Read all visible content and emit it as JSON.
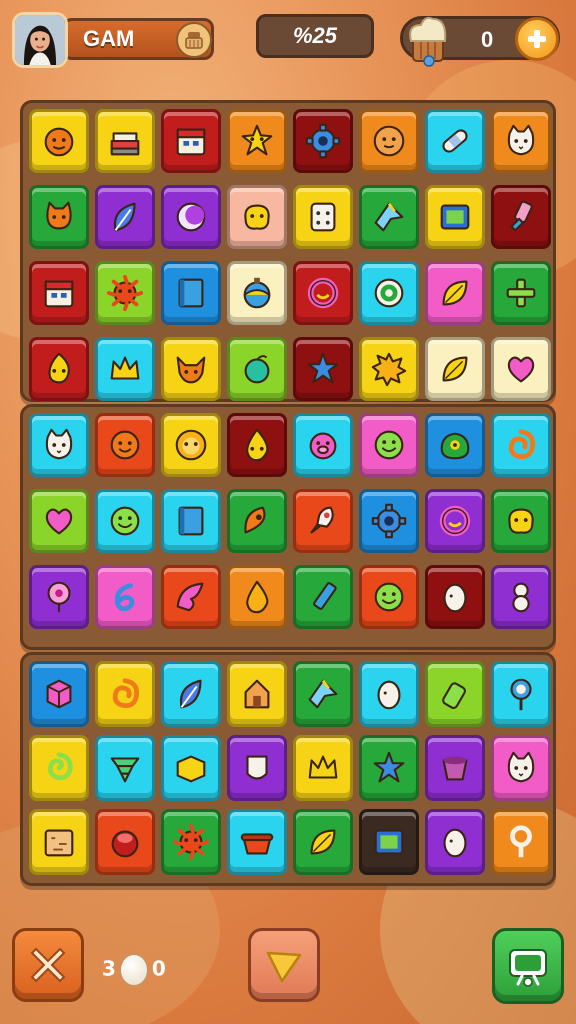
{
  "header": {
    "player_name": "GAM",
    "score": "%25",
    "coins": "0"
  },
  "footer": {
    "counter_left": "3",
    "counter_right": "0"
  },
  "colors": {
    "yellow": "#f7d316",
    "orange": "#f08a1c",
    "red": "#c21d1d",
    "blue": "#1f8fe0",
    "cyan": "#2ad3ee",
    "green": "#27a83a",
    "lime": "#8bd42a",
    "purple": "#8f2ed1",
    "pink": "#f25cc7",
    "cream": "#fbf0c0",
    "redorange": "#e8481a",
    "darkred": "#8e1010",
    "dark": "#3a2a22",
    "peach": "#f7b7a0"
  },
  "boards": [
    {
      "rows": [
        [
          [
            "yellow",
            "face-orange"
          ],
          [
            "yellow",
            "books"
          ],
          [
            "red",
            "calendar"
          ],
          [
            "orange",
            "star-creature"
          ],
          [
            "darkred",
            "gear"
          ],
          [
            "orange",
            "cookie"
          ],
          [
            "cyan",
            "bandage"
          ],
          [
            "orange",
            "cat"
          ]
        ],
        [
          [
            "green",
            "cat-face"
          ],
          [
            "purple",
            "feather"
          ],
          [
            "purple",
            "moon"
          ],
          [
            "peach",
            "blob"
          ],
          [
            "yellow",
            "dice"
          ],
          [
            "green",
            "bird"
          ],
          [
            "yellow",
            "card"
          ],
          [
            "darkred",
            "brush"
          ]
        ],
        [
          [
            "red",
            "calendar"
          ],
          [
            "lime",
            "sun-face"
          ],
          [
            "blue",
            "book"
          ],
          [
            "cream",
            "ball"
          ],
          [
            "red",
            "ring"
          ],
          [
            "cyan",
            "target"
          ],
          [
            "pink",
            "leaf"
          ],
          [
            "green",
            "plus"
          ]
        ],
        [
          [
            "red",
            "flame-face"
          ],
          [
            "cyan",
            "crown"
          ],
          [
            "yellow",
            "fox"
          ],
          [
            "lime",
            "fruit"
          ],
          [
            "darkred",
            "star"
          ],
          [
            "yellow",
            "burst"
          ],
          [
            "cream",
            "leaf"
          ],
          [
            "cream",
            "heart"
          ]
        ]
      ]
    },
    {
      "rows": [
        [
          [
            "cyan",
            "cat"
          ],
          [
            "redorange",
            "face"
          ],
          [
            "yellow",
            "lion"
          ],
          [
            "darkred",
            "drop-face"
          ],
          [
            "cyan",
            "pig"
          ],
          [
            "pink",
            "smile"
          ],
          [
            "blue",
            "monster"
          ],
          [
            "cyan",
            "swirl"
          ]
        ],
        [
          [
            "lime",
            "heart"
          ],
          [
            "cyan",
            "smile"
          ],
          [
            "cyan",
            "book"
          ],
          [
            "green",
            "seed"
          ],
          [
            "redorange",
            "rocket"
          ],
          [
            "blue",
            "gear"
          ],
          [
            "purple",
            "ring"
          ],
          [
            "green",
            "blob"
          ]
        ],
        [
          [
            "purple",
            "balloon"
          ],
          [
            "pink",
            "six"
          ],
          [
            "redorange",
            "wing"
          ],
          [
            "orange",
            "drop"
          ],
          [
            "green",
            "pencil"
          ],
          [
            "redorange",
            "smile"
          ],
          [
            "darkred",
            "egg"
          ],
          [
            "purple",
            "eight"
          ]
        ]
      ]
    },
    {
      "rows": [
        [
          [
            "blue",
            "cube"
          ],
          [
            "yellow",
            "swirl"
          ],
          [
            "cyan",
            "feather"
          ],
          [
            "yellow",
            "house"
          ],
          [
            "green",
            "bird"
          ],
          [
            "cyan",
            "egg"
          ],
          [
            "lime",
            "bottle"
          ],
          [
            "cyan",
            "lollipop"
          ]
        ],
        [
          [
            "yellow",
            "spiral"
          ],
          [
            "cyan",
            "tornado"
          ],
          [
            "cyan",
            "box"
          ],
          [
            "purple",
            "shield"
          ],
          [
            "yellow",
            "crown"
          ],
          [
            "green",
            "star"
          ],
          [
            "purple",
            "cup"
          ],
          [
            "pink",
            "cat"
          ]
        ],
        [
          [
            "yellow",
            "package"
          ],
          [
            "redorange",
            "button"
          ],
          [
            "green",
            "sun-face"
          ],
          [
            "cyan",
            "pot"
          ],
          [
            "green",
            "leaf"
          ],
          [
            "dark",
            "card"
          ],
          [
            "purple",
            "egg"
          ],
          [
            "orange",
            "key"
          ]
        ]
      ]
    }
  ]
}
